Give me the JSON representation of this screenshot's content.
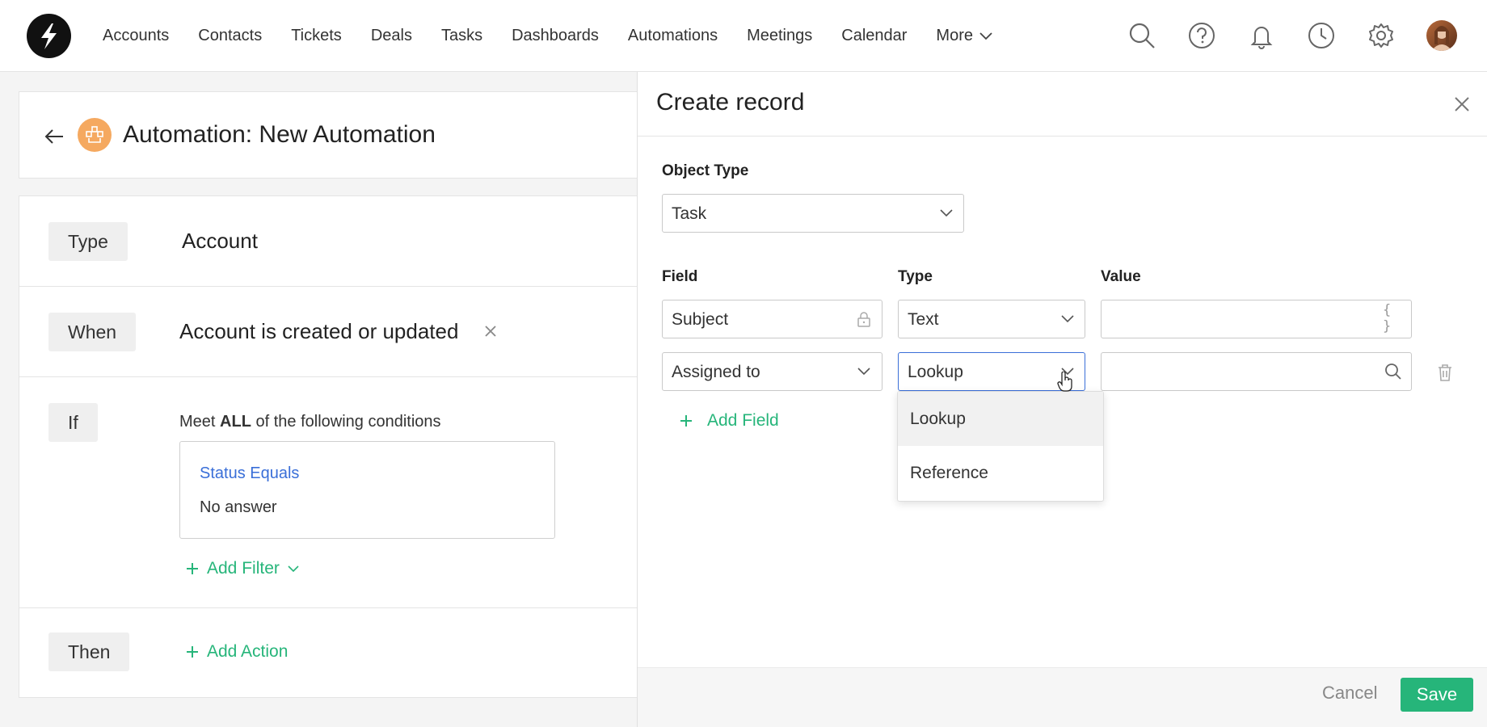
{
  "nav": {
    "links": [
      "Accounts",
      "Contacts",
      "Tickets",
      "Deals",
      "Tasks",
      "Dashboards",
      "Automations",
      "Meetings",
      "Calendar"
    ],
    "more_label": "More",
    "icons": [
      "search-icon",
      "help-icon",
      "bell-icon",
      "clock-icon",
      "gear-icon"
    ]
  },
  "header": {
    "title": "Automation: New Automation"
  },
  "rules": {
    "type_label": "Type",
    "type_value": "Account",
    "when_label": "When",
    "when_value": "Account is created or updated",
    "if_label": "If",
    "condition_prefix": "Meet ",
    "condition_bold": "ALL",
    "condition_suffix": " of the following conditions",
    "filter_title": "Status Equals",
    "filter_value": "No answer",
    "add_filter": "Add Filter",
    "then_label": "Then",
    "add_action": "Add Action"
  },
  "drawer": {
    "title": "Create record",
    "object_type_label": "Object Type",
    "object_type_value": "Task",
    "col_field": "Field",
    "col_type": "Type",
    "col_value": "Value",
    "rows": [
      {
        "field": "Subject",
        "type": "Text",
        "value": ""
      },
      {
        "field": "Assigned to",
        "type": "Lookup",
        "value": ""
      }
    ],
    "add_field": "Add Field",
    "type_options": [
      "Lookup",
      "Reference"
    ],
    "cancel": "Cancel",
    "save": "Save"
  },
  "colors": {
    "accent_green": "#26b57a",
    "link_blue": "#3a6fd8",
    "automation_orange": "#f5a960"
  }
}
